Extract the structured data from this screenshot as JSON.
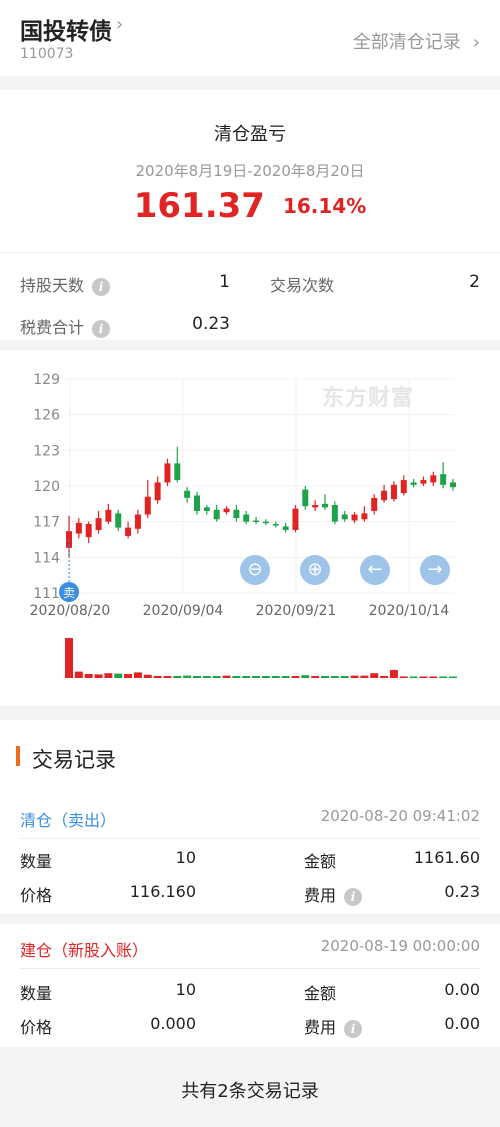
{
  "header": {
    "stock_name": "国投转债",
    "stock_code": "110073",
    "all_records_label": "全部清仓记录"
  },
  "summary": {
    "title": "清仓盈亏",
    "date_range": "2020年8月19日-2020年8月20日",
    "pnl_amount": "161.37",
    "pnl_percent": "16.14%",
    "holding_days_label": "持股天数",
    "holding_days": "1",
    "trade_count_label": "交易次数",
    "trade_count": "2",
    "fee_total_label": "税费合计",
    "fee_total": "0.23"
  },
  "colors": {
    "up": "#e02424",
    "down": "#1fa34a",
    "accent": "#3b8ee0",
    "title_bar": "#ef6b1e"
  },
  "chart": {
    "watermark": "东方财富",
    "sell_marker": "卖",
    "controls": [
      "zoom-out",
      "zoom-in",
      "prev",
      "next"
    ]
  },
  "chart_data": {
    "type": "candlestick",
    "y_ticks": [
      "129",
      "126",
      "123",
      "120",
      "117",
      "114",
      "111"
    ],
    "x_ticks": [
      "2020/08/20",
      "2020/09/04",
      "2020/09/21",
      "2020/10/14"
    ],
    "ylim": [
      111,
      129
    ],
    "candles": [
      {
        "o": 114.8,
        "c": 116.2,
        "h": 117.5,
        "l": 114.0
      },
      {
        "o": 116.0,
        "c": 116.9,
        "h": 117.3,
        "l": 115.6
      },
      {
        "o": 115.7,
        "c": 116.8,
        "h": 117.0,
        "l": 115.2
      },
      {
        "o": 116.3,
        "c": 117.3,
        "h": 117.9,
        "l": 116.0
      },
      {
        "o": 117.0,
        "c": 118.0,
        "h": 118.5,
        "l": 116.8
      },
      {
        "o": 117.7,
        "c": 116.5,
        "h": 118.0,
        "l": 116.2
      },
      {
        "o": 115.8,
        "c": 116.5,
        "h": 117.0,
        "l": 115.6
      },
      {
        "o": 116.4,
        "c": 117.6,
        "h": 118.0,
        "l": 116.0
      },
      {
        "o": 117.6,
        "c": 119.1,
        "h": 120.5,
        "l": 117.3
      },
      {
        "o": 118.8,
        "c": 120.3,
        "h": 120.8,
        "l": 118.5
      },
      {
        "o": 120.3,
        "c": 121.9,
        "h": 122.3,
        "l": 120.0
      },
      {
        "o": 121.9,
        "c": 120.5,
        "h": 123.3,
        "l": 120.3
      },
      {
        "o": 119.6,
        "c": 119.0,
        "h": 119.9,
        "l": 118.6
      },
      {
        "o": 119.2,
        "c": 117.9,
        "h": 119.5,
        "l": 117.6
      },
      {
        "o": 118.2,
        "c": 117.9,
        "h": 118.4,
        "l": 117.6
      },
      {
        "o": 118.0,
        "c": 117.2,
        "h": 118.4,
        "l": 117.0
      },
      {
        "o": 117.8,
        "c": 118.1,
        "h": 118.3,
        "l": 117.6
      },
      {
        "o": 118.0,
        "c": 117.3,
        "h": 118.4,
        "l": 117.0
      },
      {
        "o": 117.6,
        "c": 117.0,
        "h": 117.9,
        "l": 116.8
      },
      {
        "o": 117.1,
        "c": 117.0,
        "h": 117.4,
        "l": 116.8
      },
      {
        "o": 117.0,
        "c": 116.9,
        "h": 117.2,
        "l": 116.7
      },
      {
        "o": 116.8,
        "c": 116.7,
        "h": 117.0,
        "l": 116.5
      },
      {
        "o": 116.6,
        "c": 116.3,
        "h": 116.9,
        "l": 116.1
      },
      {
        "o": 116.3,
        "c": 118.1,
        "h": 118.4,
        "l": 116.1
      },
      {
        "o": 119.7,
        "c": 118.3,
        "h": 120.0,
        "l": 118.0
      },
      {
        "o": 118.2,
        "c": 118.4,
        "h": 118.8,
        "l": 117.9
      },
      {
        "o": 118.5,
        "c": 118.2,
        "h": 119.3,
        "l": 118.0
      },
      {
        "o": 118.4,
        "c": 117.0,
        "h": 118.7,
        "l": 116.8
      },
      {
        "o": 117.6,
        "c": 117.2,
        "h": 117.9,
        "l": 117.0
      },
      {
        "o": 117.1,
        "c": 117.6,
        "h": 117.8,
        "l": 116.9
      },
      {
        "o": 117.2,
        "c": 117.7,
        "h": 118.3,
        "l": 117.0
      },
      {
        "o": 117.9,
        "c": 119.0,
        "h": 119.3,
        "l": 117.6
      },
      {
        "o": 118.8,
        "c": 119.6,
        "h": 120.1,
        "l": 118.6
      },
      {
        "o": 118.9,
        "c": 120.1,
        "h": 120.4,
        "l": 118.7
      },
      {
        "o": 119.4,
        "c": 120.5,
        "h": 120.9,
        "l": 119.2
      },
      {
        "o": 120.3,
        "c": 120.1,
        "h": 120.6,
        "l": 119.9
      },
      {
        "o": 120.2,
        "c": 120.5,
        "h": 120.8,
        "l": 120.0
      },
      {
        "o": 120.3,
        "c": 120.9,
        "h": 121.2,
        "l": 120.0
      },
      {
        "o": 121.0,
        "c": 120.1,
        "h": 122.0,
        "l": 119.8
      },
      {
        "o": 120.3,
        "c": 119.9,
        "h": 120.6,
        "l": 119.6
      }
    ],
    "volumes": [
      100,
      16,
      10,
      9,
      12,
      11,
      10,
      14,
      8,
      5,
      5,
      5,
      6,
      5,
      5,
      5,
      6,
      5,
      5,
      5,
      5,
      5,
      5,
      5,
      7,
      5,
      5,
      5,
      5,
      6,
      6,
      12,
      5,
      20,
      4,
      3,
      3,
      3,
      3,
      3
    ]
  },
  "records": {
    "title": "交易记录",
    "qty_label": "数量",
    "price_label": "价格",
    "amount_label": "金额",
    "fee_label": "费用",
    "items": [
      {
        "type": "清仓（卖出）",
        "time": "2020-08-20 09:41:02",
        "qty": "10",
        "price": "116.160",
        "amount": "1161.60",
        "fee": "0.23"
      },
      {
        "type": "建仓（新股入账）",
        "time": "2020-08-19 00:00:00",
        "qty": "10",
        "price": "0.000",
        "amount": "0.00",
        "fee": "0.00"
      }
    ],
    "footer": "共有2条交易记录"
  }
}
